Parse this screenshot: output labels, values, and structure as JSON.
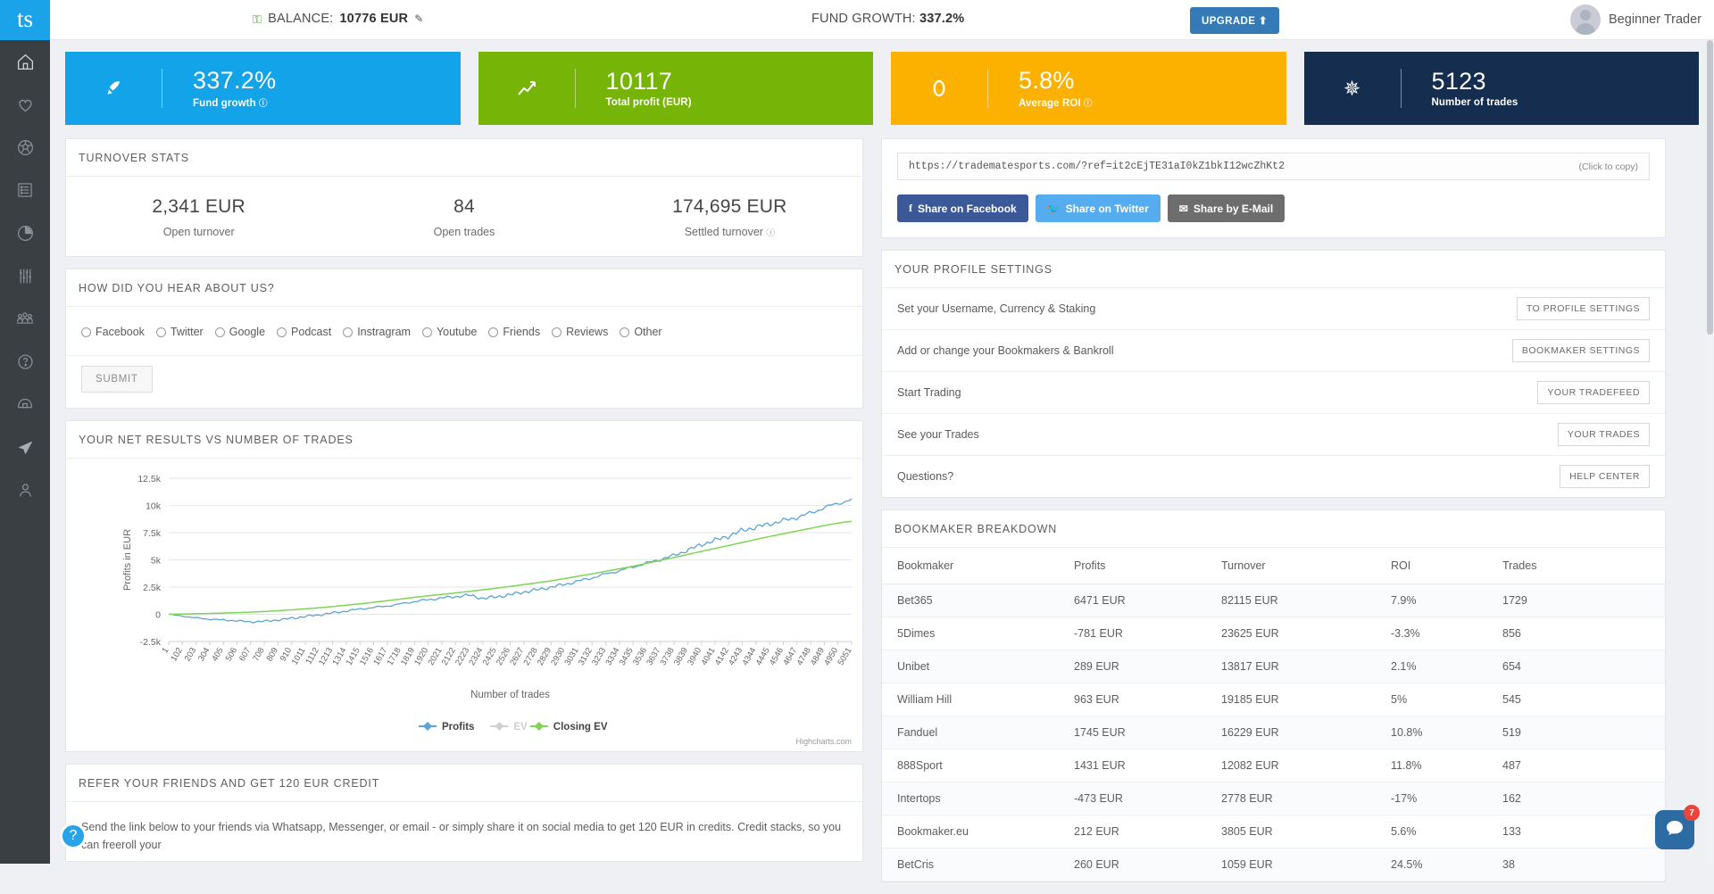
{
  "topbar": {
    "logo_text": "ts",
    "balance_label": "BALANCE:",
    "balance_value": "10776 EUR",
    "wifi_icon": "wifi-icon",
    "edit_icon": "pencil-icon",
    "fund_growth_label": "FUND GROWTH:",
    "fund_growth_value": "337.2%",
    "upgrade_label": "UPGRADE ⬆",
    "user_name": "Beginner Trader"
  },
  "sidebar": {
    "items": [
      {
        "name": "home",
        "icon": "home-icon"
      },
      {
        "name": "favourites",
        "icon": "heart-icon"
      },
      {
        "name": "sports",
        "icon": "soccer-ball-icon"
      },
      {
        "name": "tradefeed",
        "icon": "list-icon"
      },
      {
        "name": "statistics",
        "icon": "pie-chart-icon"
      },
      {
        "name": "settings-sliders",
        "icon": "sliders-icon"
      },
      {
        "name": "community",
        "icon": "people-icon"
      },
      {
        "name": "help",
        "icon": "question-circle-icon"
      },
      {
        "name": "academy",
        "icon": "cap-icon"
      },
      {
        "name": "messages",
        "icon": "paper-plane-icon"
      },
      {
        "name": "account",
        "icon": "user-icon"
      }
    ]
  },
  "cards": [
    {
      "icon": "rocket-icon",
      "value": "337.2%",
      "label": "Fund growth",
      "help": "?",
      "color": "#12a3e8"
    },
    {
      "icon": "chart-line-icon",
      "value": "10117",
      "label": "Total profit (EUR)",
      "help": "",
      "color": "#76b507"
    },
    {
      "icon": "circle-icon",
      "value": "5.8%",
      "label": "Average ROI",
      "help": "?",
      "color": "#fcb100"
    },
    {
      "icon": "asterisk-icon",
      "value": "5123",
      "label": "Number of trades",
      "help": "",
      "color": "#152d4e"
    }
  ],
  "turnover": {
    "title": "TURNOVER STATS",
    "cells": [
      {
        "value": "2,341 EUR",
        "label": "Open turnover",
        "help": ""
      },
      {
        "value": "84",
        "label": "Open trades",
        "help": ""
      },
      {
        "value": "174,695 EUR",
        "label": "Settled turnover",
        "help": "?"
      }
    ]
  },
  "hear_about": {
    "title": "HOW DID YOU HEAR ABOUT US?",
    "options": [
      "Facebook",
      "Twitter",
      "Google",
      "Podcast",
      "Instragram",
      "Youtube",
      "Friends",
      "Reviews",
      "Other"
    ],
    "submit_label": "SUBMIT"
  },
  "chart_panel": {
    "title": "YOUR NET RESULTS VS NUMBER OF TRADES",
    "credit": "Highcharts.com"
  },
  "chart_data": {
    "type": "line",
    "title": "YOUR NET RESULTS VS NUMBER OF TRADES",
    "xlabel": "Number of trades",
    "ylabel": "Profits in EUR",
    "ylim": [
      -2500,
      12500
    ],
    "yticks": [
      "-2.5k",
      "0",
      "2.5k",
      "5k",
      "7.5k",
      "10k",
      "12.5k"
    ],
    "ytick_values": [
      -2500,
      0,
      2500,
      5000,
      7500,
      10000,
      12500
    ],
    "grid": true,
    "legend_position": "bottom",
    "xticks": [
      "1",
      "102",
      "203",
      "304",
      "405",
      "506",
      "607",
      "708",
      "809",
      "910",
      "1011",
      "1112",
      "1213",
      "1314",
      "1415",
      "1516",
      "1617",
      "1718",
      "1819",
      "1920",
      "2021",
      "2122",
      "2223",
      "2324",
      "2425",
      "2526",
      "2627",
      "2728",
      "2829",
      "2930",
      "3031",
      "3132",
      "3233",
      "3334",
      "3435",
      "3536",
      "3637",
      "3738",
      "3839",
      "3940",
      "4041",
      "4142",
      "4243",
      "4344",
      "4445",
      "4546",
      "4647",
      "4748",
      "4849",
      "4950",
      "5051"
    ],
    "series": [
      {
        "name": "Profits",
        "color": "#5ba4d6",
        "enabled": true,
        "x": [
          1,
          102,
          203,
          304,
          405,
          506,
          607,
          708,
          809,
          910,
          1011,
          1112,
          1213,
          1314,
          1415,
          1516,
          1617,
          1718,
          1819,
          1920,
          2021,
          2122,
          2223,
          2324,
          2425,
          2526,
          2627,
          2728,
          2829,
          2930,
          3031,
          3132,
          3233,
          3334,
          3435,
          3536,
          3637,
          3738,
          3839,
          3940,
          4041,
          4142,
          4243,
          4344,
          4445,
          4546,
          4647,
          4748,
          4849,
          4950,
          5051
        ],
        "values": [
          0,
          -170,
          -330,
          -450,
          -520,
          -600,
          -700,
          -640,
          -520,
          -370,
          -200,
          -60,
          120,
          300,
          480,
          620,
          760,
          950,
          1180,
          1340,
          1500,
          1620,
          1760,
          1450,
          1600,
          1800,
          2050,
          2250,
          2500,
          2750,
          3050,
          3350,
          3700,
          4000,
          4350,
          4700,
          5050,
          5400,
          5900,
          6400,
          6800,
          7200,
          7700,
          8000,
          8300,
          8600,
          8900,
          9300,
          9800,
          10200,
          10500
        ]
      },
      {
        "name": "EV",
        "color": "#bdbdbd",
        "enabled": false,
        "x": [],
        "values": []
      },
      {
        "name": "Closing EV",
        "color": "#7ed456",
        "enabled": true,
        "x": [
          1,
          102,
          203,
          304,
          405,
          506,
          607,
          708,
          809,
          910,
          1011,
          1112,
          1213,
          1314,
          1415,
          1516,
          1617,
          1718,
          1819,
          1920,
          2021,
          2122,
          2223,
          2324,
          2425,
          2526,
          2627,
          2728,
          2829,
          2930,
          3031,
          3132,
          3233,
          3334,
          3435,
          3536,
          3637,
          3738,
          3839,
          3940,
          4041,
          4142,
          4243,
          4344,
          4445,
          4546,
          4647,
          4748,
          4849,
          4950,
          5051
        ],
        "values": [
          0,
          20,
          50,
          80,
          110,
          150,
          200,
          260,
          330,
          410,
          500,
          600,
          710,
          830,
          960,
          1100,
          1250,
          1400,
          1560,
          1700,
          1830,
          1960,
          2100,
          2250,
          2400,
          2560,
          2730,
          2900,
          3080,
          3280,
          3500,
          3720,
          3950,
          4180,
          4420,
          4680,
          4950,
          5220,
          5500,
          5780,
          6050,
          6320,
          6600,
          6880,
          7150,
          7400,
          7650,
          7900,
          8150,
          8380,
          8550
        ]
      }
    ],
    "legend": [
      {
        "label": "Profits",
        "color": "#5ba4d6",
        "dimmed": false
      },
      {
        "label": "EV",
        "color": "#cccccc",
        "dimmed": true
      },
      {
        "label": "Closing EV",
        "color": "#7ed456",
        "dimmed": false
      }
    ]
  },
  "refer": {
    "title": "REFER YOUR FRIENDS AND GET 120 EUR CREDIT",
    "body": "Send the link below to your friends via Whatsapp, Messenger, or email - or simply share it on social media to get 120 EUR in credits. Credit stacks, so you can freeroll your"
  },
  "share": {
    "url": "https://tradematesports.com/?ref=it2cEjTE31aI0kZ1bkI12wcZhKt2",
    "click_to_copy": "(Click to copy)",
    "facebook": "Share on Facebook",
    "twitter": "Share on Twitter",
    "email": "Share by E-Mail"
  },
  "profile_settings": {
    "title": "YOUR PROFILE SETTINGS",
    "rows": [
      {
        "label": "Set your Username, Currency & Staking",
        "button": "TO PROFILE SETTINGS"
      },
      {
        "label": "Add or change your Bookmakers & Bankroll",
        "button": "BOOKMAKER SETTINGS"
      },
      {
        "label": "Start Trading",
        "button": "YOUR TRADEFEED"
      },
      {
        "label": "See your Trades",
        "button": "YOUR TRADES"
      },
      {
        "label": "Questions?",
        "button": "HELP CENTER"
      }
    ]
  },
  "bookmaker": {
    "title": "BOOKMAKER BREAKDOWN",
    "columns": [
      "Bookmaker",
      "Profits",
      "Turnover",
      "ROI",
      "Trades"
    ],
    "rows": [
      [
        "Bet365",
        "6471 EUR",
        "82115 EUR",
        "7.9%",
        "1729"
      ],
      [
        "5Dimes",
        "-781 EUR",
        "23625 EUR",
        "-3.3%",
        "856"
      ],
      [
        "Unibet",
        "289 EUR",
        "13817 EUR",
        "2.1%",
        "654"
      ],
      [
        "William Hill",
        "963 EUR",
        "19185 EUR",
        "5%",
        "545"
      ],
      [
        "Fanduel",
        "1745 EUR",
        "16229 EUR",
        "10.8%",
        "519"
      ],
      [
        "888Sport",
        "1431 EUR",
        "12082 EUR",
        "11.8%",
        "487"
      ],
      [
        "Intertops",
        "-473 EUR",
        "2778 EUR",
        "-17%",
        "162"
      ],
      [
        "Bookmaker.eu",
        "212 EUR",
        "3805 EUR",
        "5.6%",
        "133"
      ],
      [
        "BetCris",
        "260 EUR",
        "1059 EUR",
        "24.5%",
        "38"
      ]
    ]
  },
  "widgets": {
    "help_label": "?",
    "chat_badge": "7"
  }
}
